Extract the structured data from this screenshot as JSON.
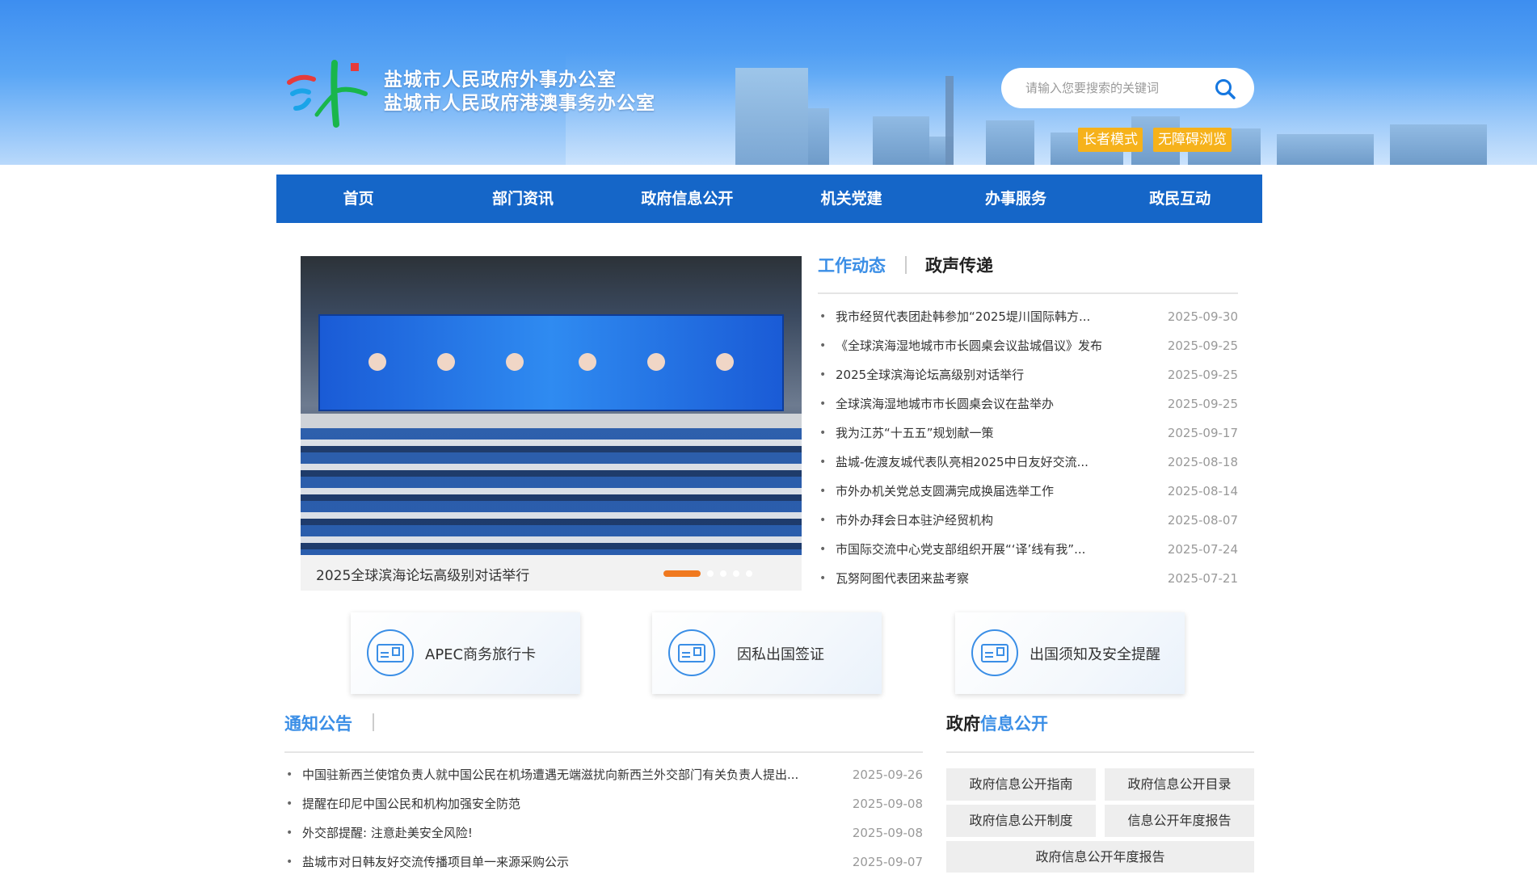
{
  "header": {
    "site_name_line1": "盐城市人民政府外事办公室",
    "site_name_line2": "盐城市人民政府港澳事务办公室",
    "search_placeholder": "请输入您要搜索的关键词",
    "elder_mode": "长者模式",
    "accessibility": "无障碍浏览",
    "colors": {
      "accent_button": "#f6b21b"
    }
  },
  "nav": {
    "items": [
      "首页",
      "部门资讯",
      "政府信息公开",
      "机关党建",
      "办事服务",
      "政民互动"
    ],
    "color": "#1566c8"
  },
  "carousel": {
    "caption": "2025全球滨海论坛高级别对话举行",
    "dot_count": 5,
    "active_index": 0,
    "active_color": "#f0791f"
  },
  "news": {
    "tabs": [
      "工作动态",
      "政声传递"
    ],
    "active_tab": 0,
    "items": [
      {
        "title": "我市经贸代表团赴韩参加“2025堤川国际韩方...",
        "date": "2025-09-30"
      },
      {
        "title": "《全球滨海湿地城市市长圆桌会议盐城倡议》发布",
        "date": "2025-09-25"
      },
      {
        "title": "2025全球滨海论坛高级别对话举行",
        "date": "2025-09-25"
      },
      {
        "title": "全球滨海湿地城市市长圆桌会议在盐举办",
        "date": "2025-09-25"
      },
      {
        "title": "我为江苏“十五五”规划献一策",
        "date": "2025-09-17"
      },
      {
        "title": "盐城-佐渡友城代表队亮相2025中日友好交流...",
        "date": "2025-08-18"
      },
      {
        "title": "市外办机关党总支圆满完成换届选举工作",
        "date": "2025-08-14"
      },
      {
        "title": "市外办拜会日本驻沪经贸机构",
        "date": "2025-08-07"
      },
      {
        "title": "市国际交流中心党支部组织开展“‘译’线有我”...",
        "date": "2025-07-24"
      },
      {
        "title": "瓦努阿图代表团来盐考察",
        "date": "2025-07-21"
      }
    ]
  },
  "quick_links": [
    {
      "label": "APEC商务旅行卡",
      "icon": "card-icon"
    },
    {
      "label": "因私出国签证",
      "icon": "card-icon"
    },
    {
      "label": "出国须知及安全提醒",
      "icon": "card-icon"
    }
  ],
  "notice": {
    "title": "通知公告",
    "items": [
      {
        "title": "中国驻新西兰使馆负责人就中国公民在机场遭遇无端滋扰向新西兰外交部门有关负责人提出...",
        "date": "2025-09-26"
      },
      {
        "title": "提醒在印尼中国公民和机构加强安全防范",
        "date": "2025-09-08"
      },
      {
        "title": "外交部提醒: 注意赴美安全风险!",
        "date": "2025-09-08"
      },
      {
        "title": "盐城市对日韩友好交流传播项目单一来源采购公示",
        "date": "2025-09-07"
      }
    ]
  },
  "gov_info": {
    "title_part1": "政府",
    "title_part2": "信息公开",
    "buttons": [
      "政府信息公开指南",
      "政府信息公开目录",
      "政府信息公开制度",
      "信息公开年度报告",
      "政府信息公开年度报告"
    ]
  }
}
